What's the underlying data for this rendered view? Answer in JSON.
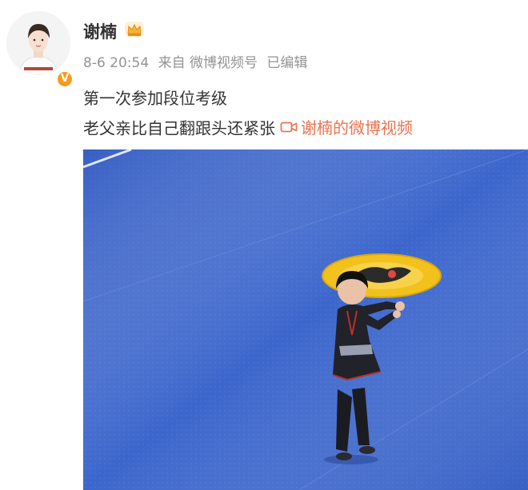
{
  "post": {
    "username": "谢楠",
    "verified_badge": "V",
    "time": "8-6 20:54",
    "source": "来自 微博视频号",
    "edited": "已编辑",
    "line1": "第一次参加段位考级",
    "line2": "老父亲比自己翻跟头还紧张",
    "video_link": "谢楠的微博视频"
  },
  "icons": {
    "crown": "crown-icon",
    "video": "video-camera-icon"
  },
  "colors": {
    "link": "#eb7350",
    "meta": "#939393",
    "badge": "#f79a1f",
    "mat": "#3a62c9"
  }
}
